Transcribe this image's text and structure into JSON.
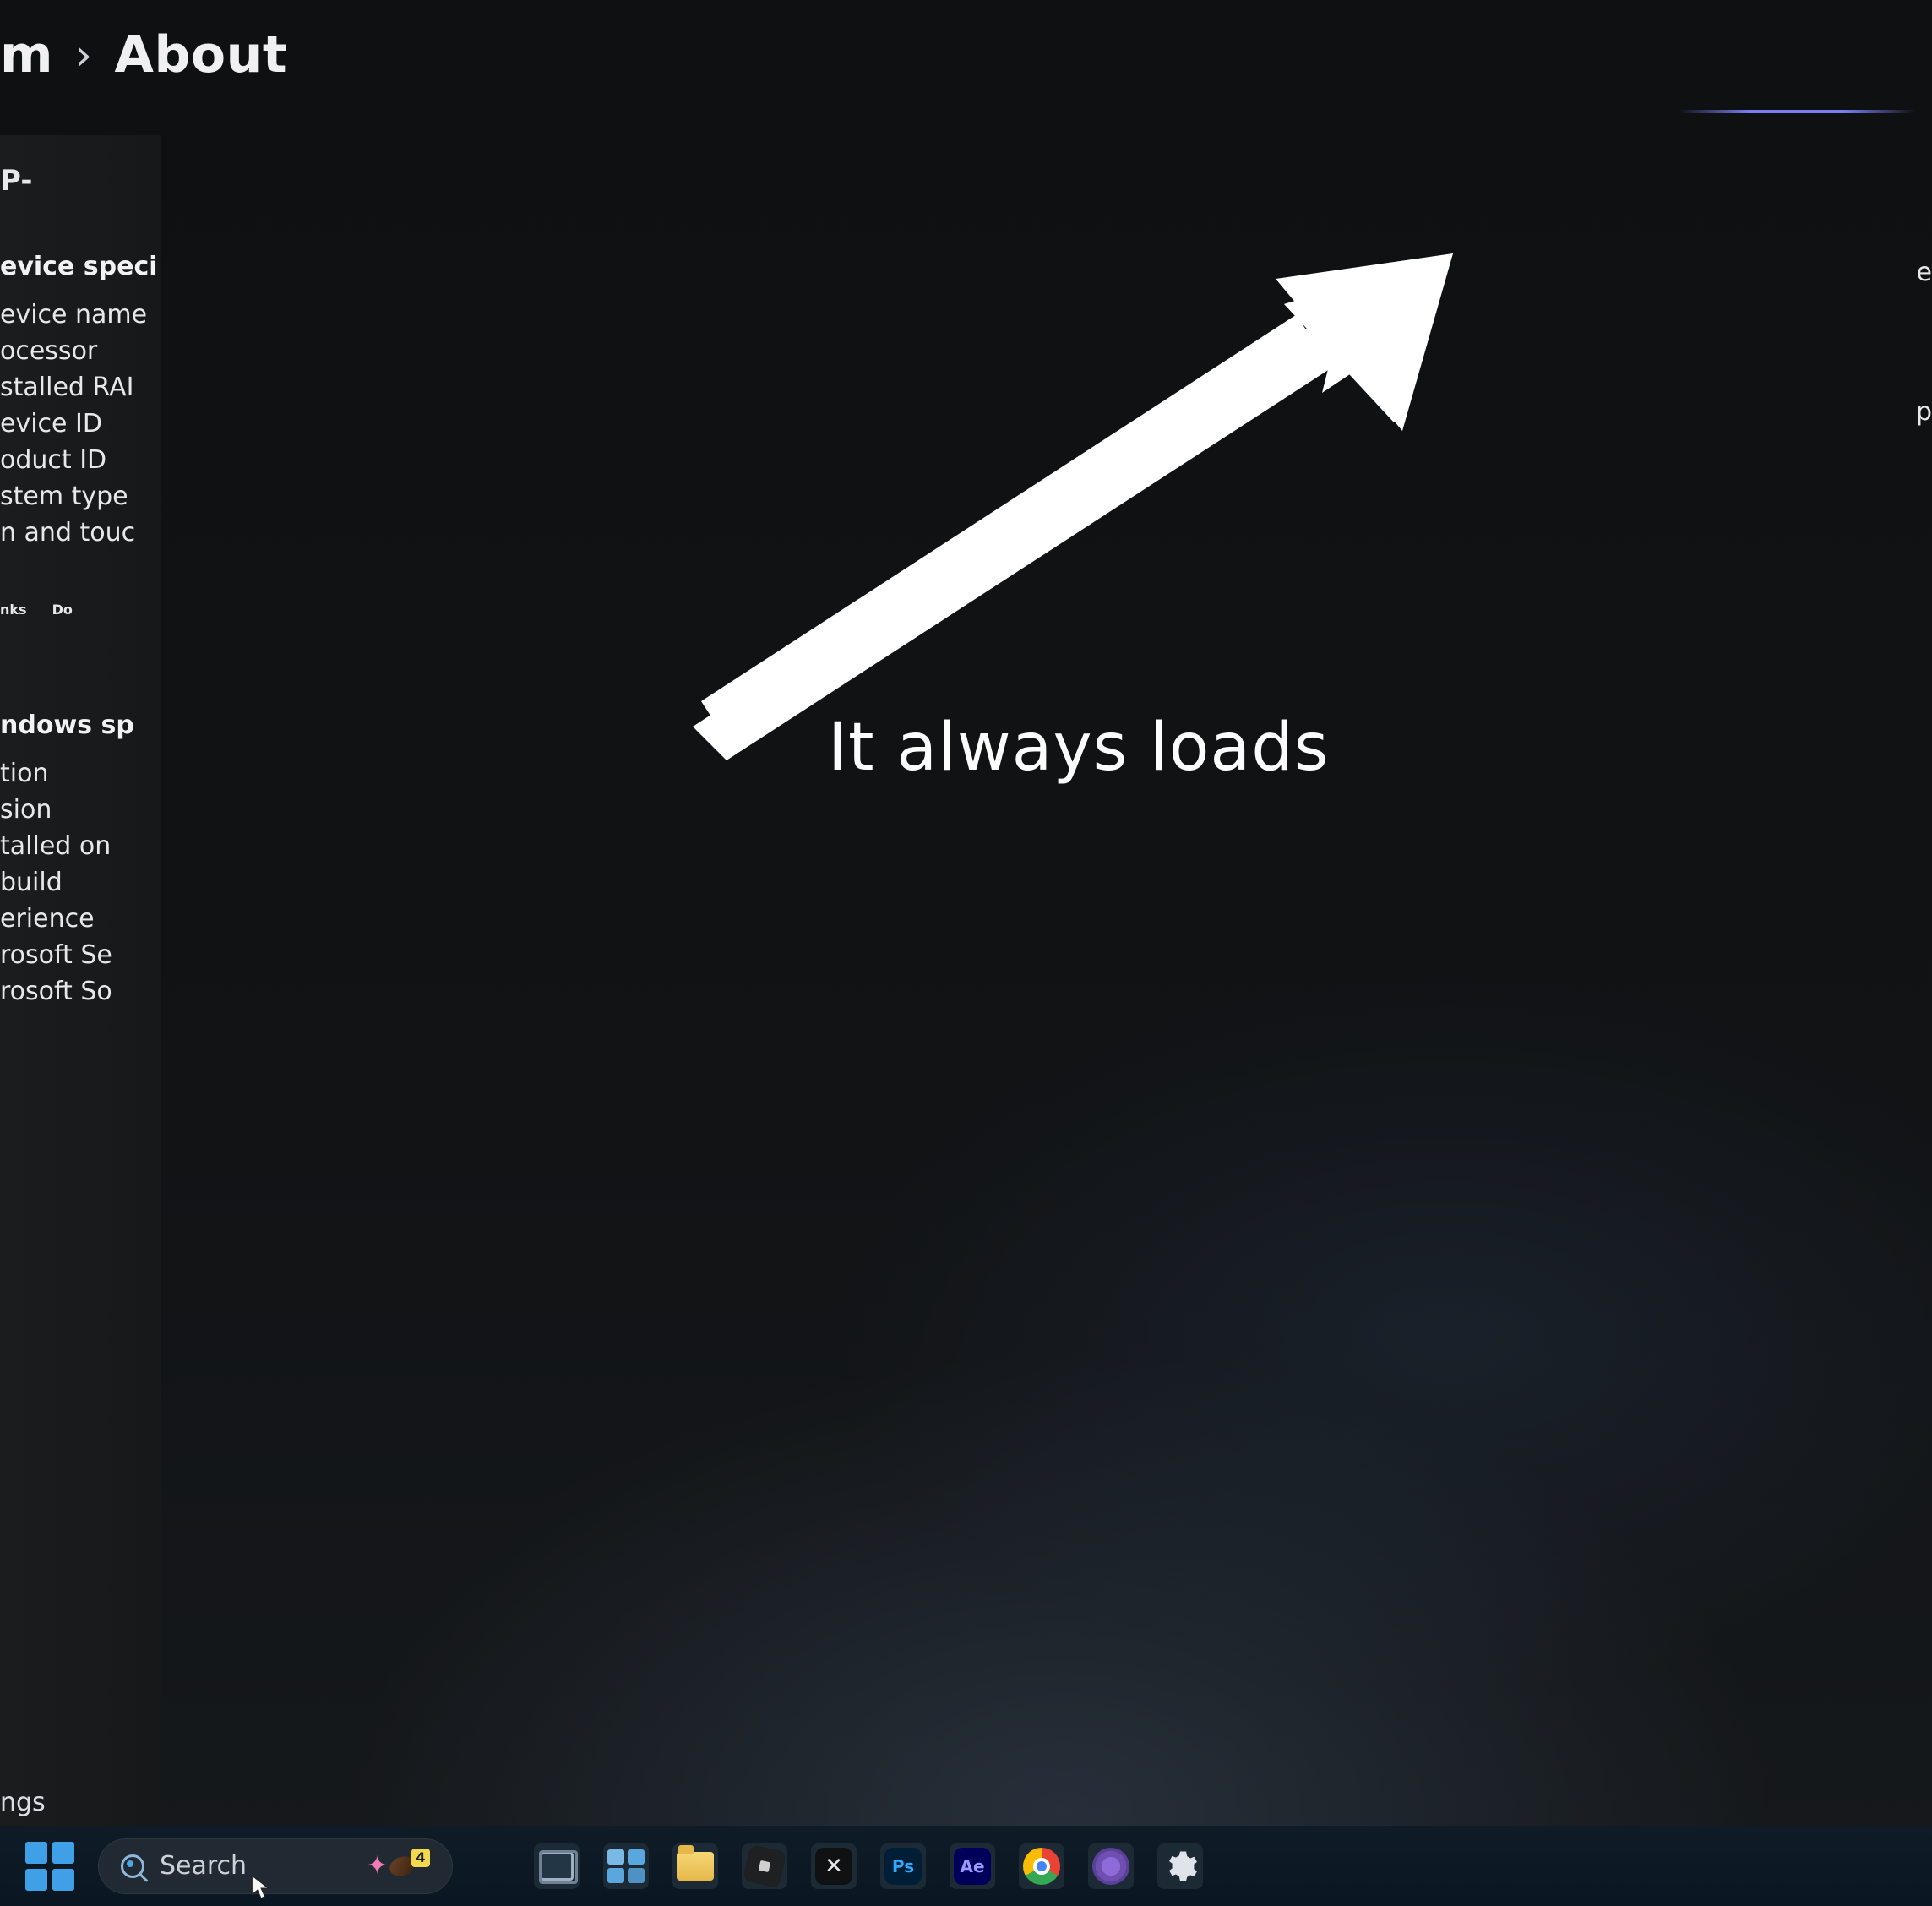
{
  "breadcrumb": {
    "parent_fragment": "m",
    "sep": "›",
    "current": "About"
  },
  "left_panel": {
    "device_name_prefix": "P-",
    "section_device": "evice speci",
    "rows_device": [
      "evice name",
      "ocessor",
      "stalled RAI",
      "evice ID",
      "oduct ID",
      "stem type",
      "n and touc"
    ],
    "links_row": {
      "left": "nks",
      "right": "Do"
    },
    "section_windows": "ndows sp",
    "rows_windows": [
      "tion",
      "sion",
      "talled on",
      "build",
      "erience",
      "rosoft Se",
      "rosoft So"
    ],
    "footer_fragment": "ngs"
  },
  "right_edge": {
    "top": "e",
    "bottom": "p"
  },
  "annotation": {
    "text": "It always loads"
  },
  "taskbar": {
    "search_placeholder": "Search",
    "search_badge": "4",
    "icons": {
      "start": "start-icon",
      "search": "search-icon",
      "taskview": "task-view-icon",
      "widgets": "widgets-icon",
      "explorer": "file-explorer-icon",
      "roblox": "roblox-icon",
      "capcut": "capcut-icon",
      "ps": "photoshop-icon",
      "ae": "after-effects-icon",
      "chrome": "chrome-icon",
      "tor": "tor-browser-icon",
      "settings": "settings-icon"
    },
    "adobe": {
      "ps": "Ps",
      "ae": "Ae",
      "cc": "✕"
    }
  }
}
